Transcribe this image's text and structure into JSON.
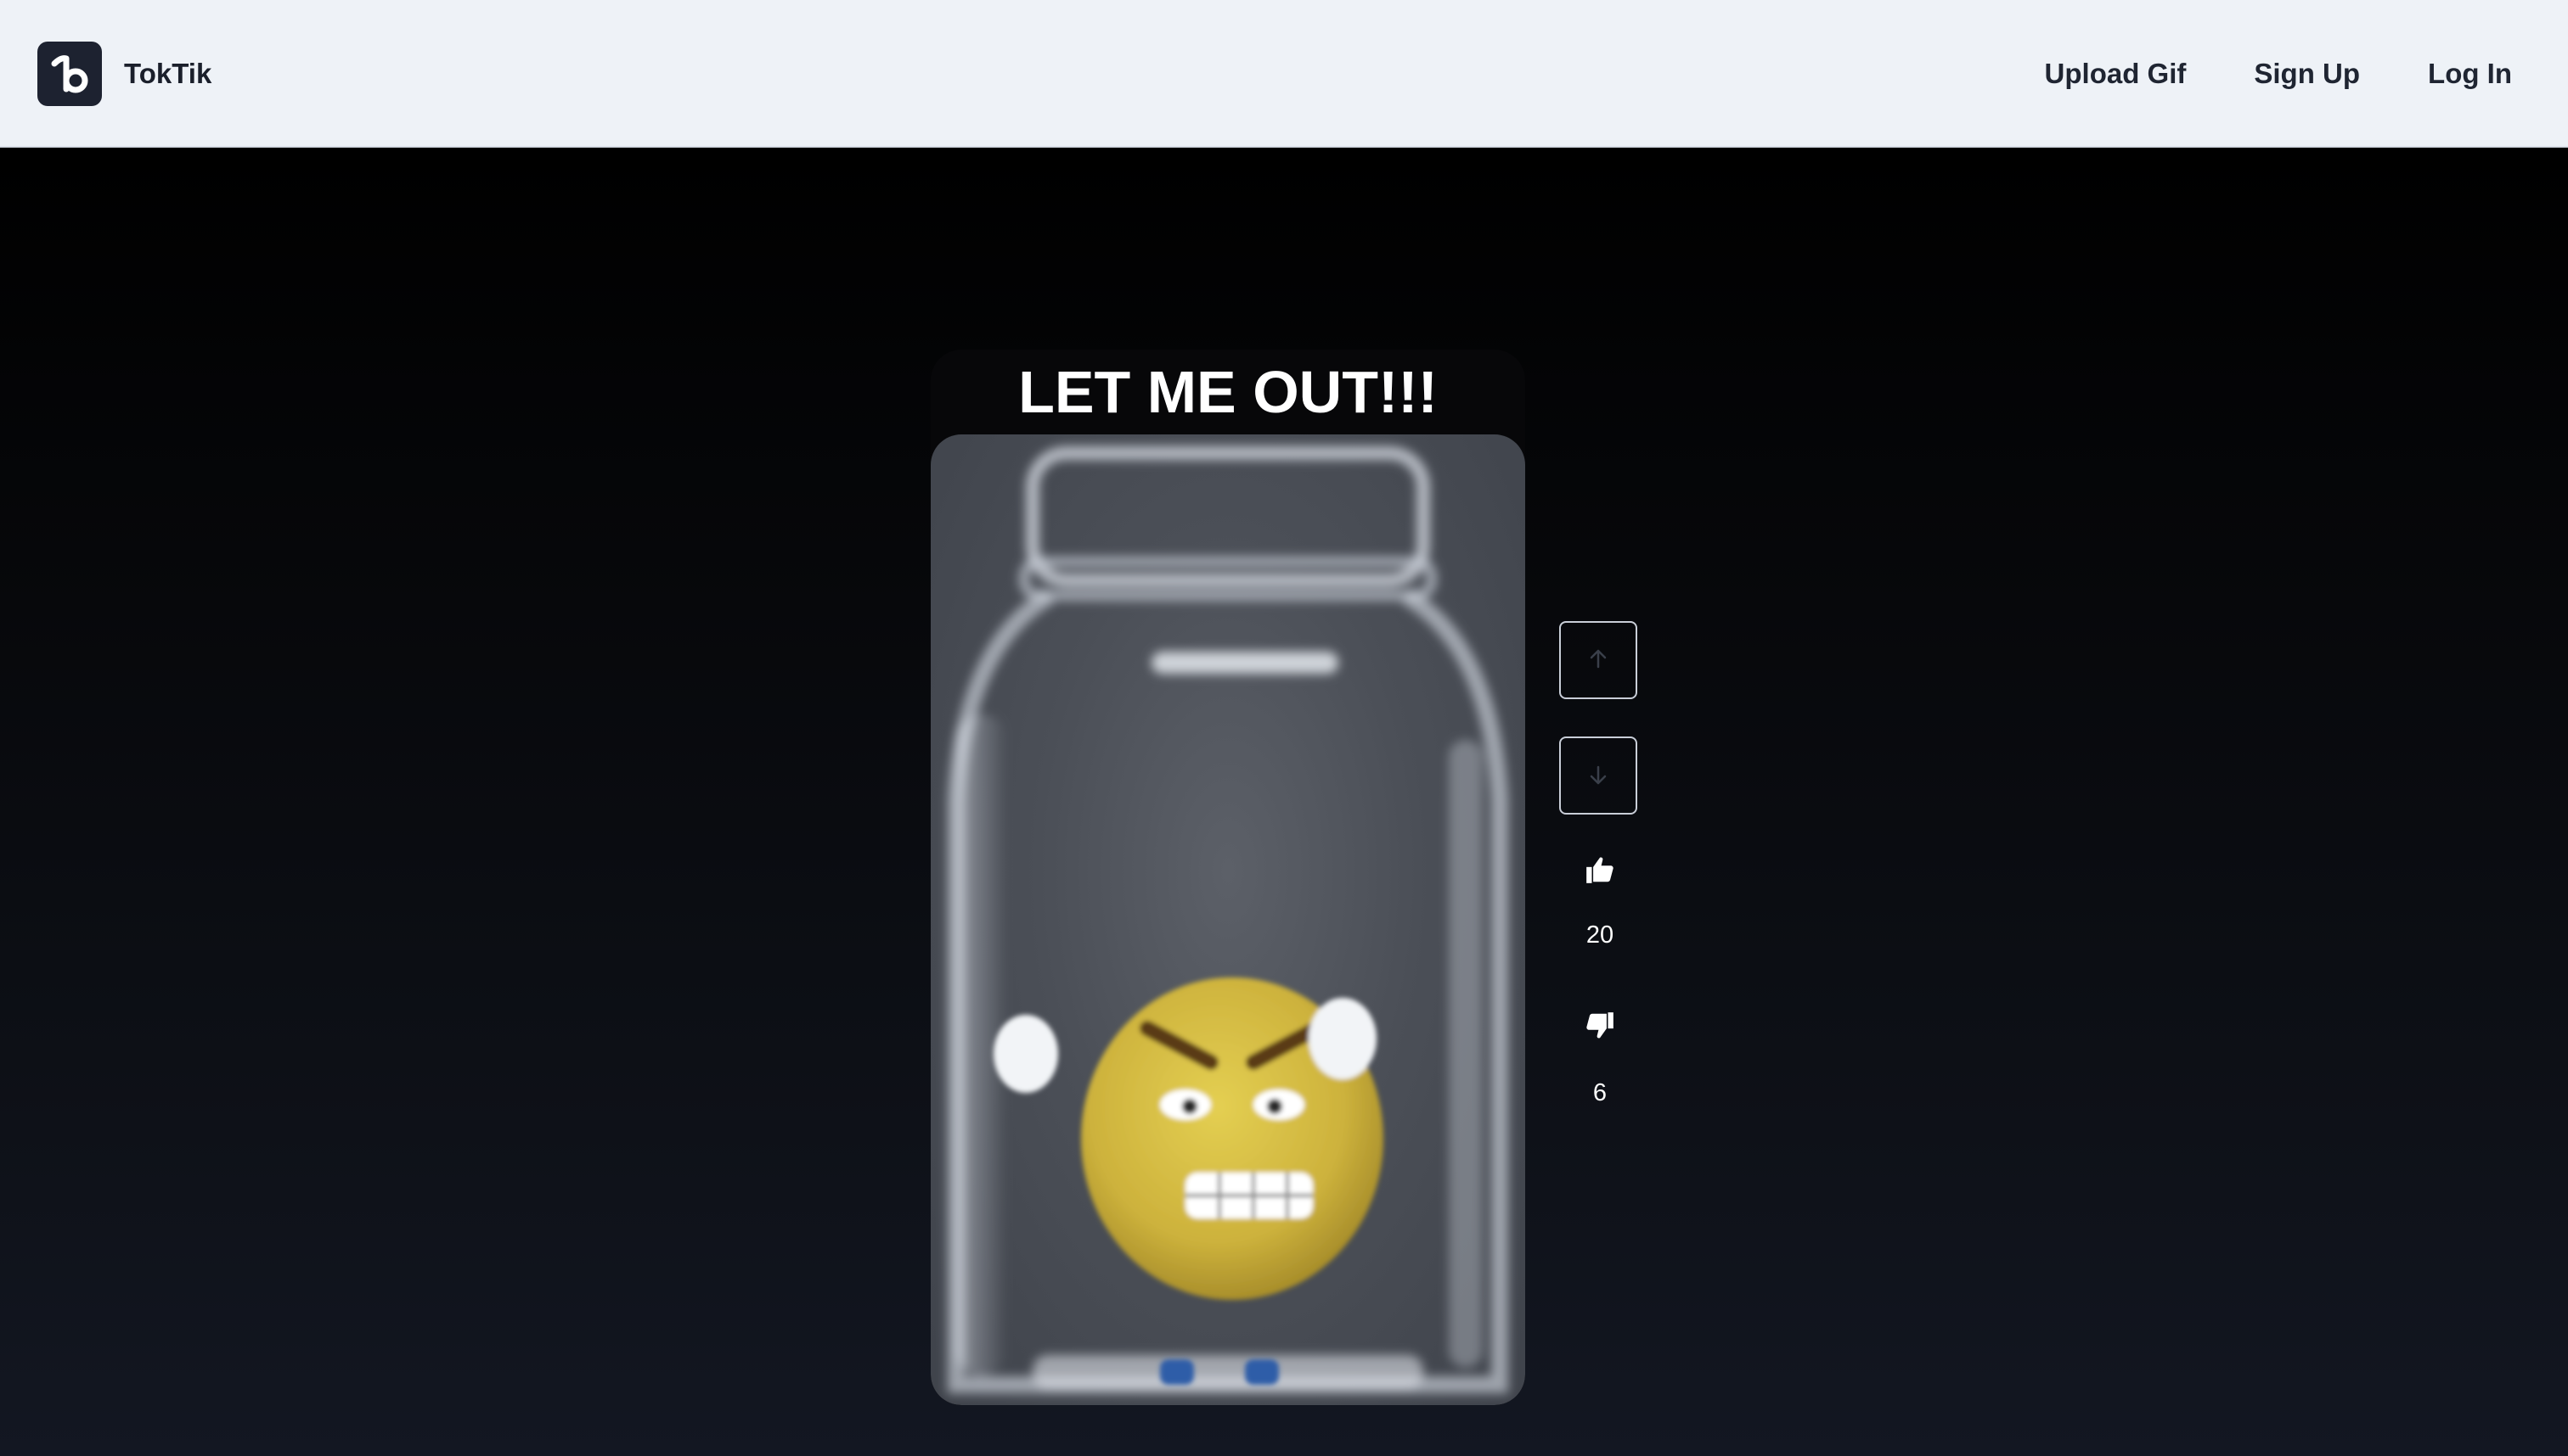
{
  "header": {
    "brand_name": "TokTik",
    "nav": {
      "upload_label": "Upload Gif",
      "signup_label": "Sign Up",
      "login_label": "Log In"
    }
  },
  "post": {
    "title": "LET ME OUT!!!",
    "likes": "20",
    "dislikes": "6"
  },
  "icons": {
    "brand": "toktik-logo-icon",
    "previous": "arrow-up-icon",
    "next": "arrow-down-icon",
    "like": "thumbs-up-icon",
    "dislike": "thumbs-down-icon"
  },
  "colors": {
    "header_bg": "#eef2f7",
    "logo_bg": "#1d2230",
    "stage_top": "#000000",
    "stage_bottom": "#131722",
    "text_light": "#ffffff",
    "text_dark": "#1f2532"
  }
}
